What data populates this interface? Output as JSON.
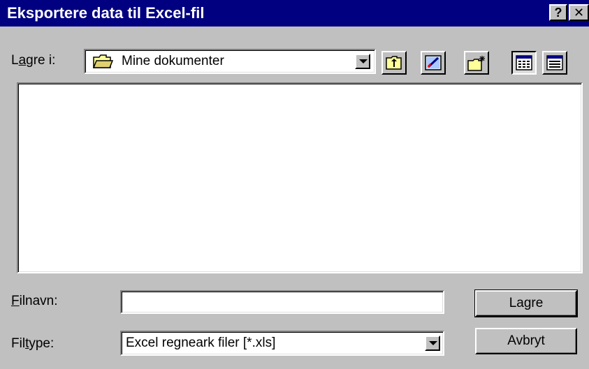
{
  "window": {
    "title": "Eksportere data til Excel-fil",
    "help_label": "?",
    "close_label": "✕"
  },
  "location": {
    "label_prefix": "L",
    "label_ul": "a",
    "label_suffix": "gre i:",
    "value": "Mine dokumenter"
  },
  "toolbar": {
    "icons": [
      "folder-up-icon",
      "desktop-icon",
      "new-folder-icon",
      "list-view-icon",
      "details-view-icon"
    ]
  },
  "filename": {
    "label_ul": "F",
    "label_suffix": "ilnavn:",
    "value": ""
  },
  "filetype": {
    "label_prefix": "Fil",
    "label_ul": "t",
    "label_suffix": "ype:",
    "value": "Excel regneark filer [*.xls]"
  },
  "buttons": {
    "save_label": "Lagre",
    "cancel_label": "Avbryt"
  },
  "colors": {
    "titlebar": "#000080",
    "face": "#c0c0c0",
    "window": "#ffffff"
  }
}
